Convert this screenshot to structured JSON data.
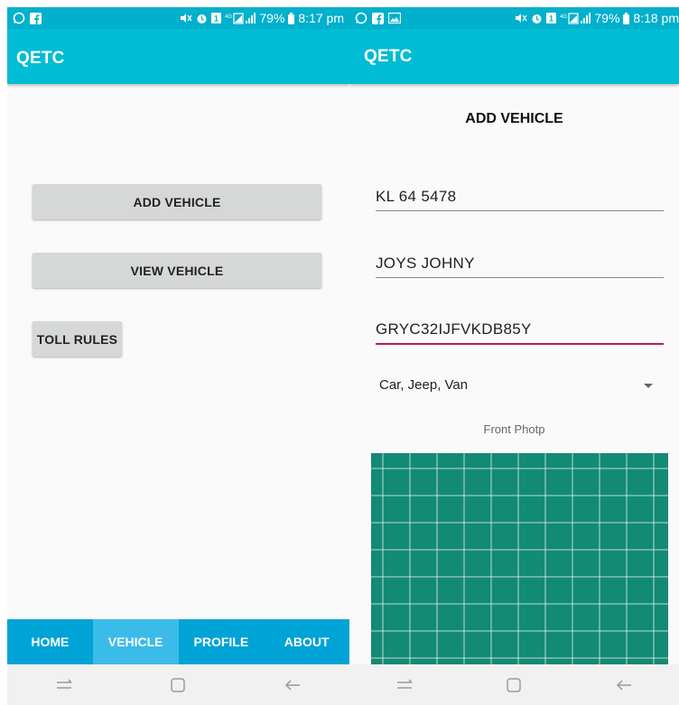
{
  "left": {
    "status": {
      "battery": "79%",
      "time": "8:17 pm"
    },
    "app_title": "QETC",
    "buttons": {
      "add_vehicle": "ADD VEHICLE",
      "view_vehicle": "VIEW VEHICLE",
      "toll_rules": "TOLL RULES"
    },
    "nav": [
      "HOME",
      "VEHICLE",
      "PROFILE",
      "ABOUT"
    ],
    "active_tab": "VEHICLE"
  },
  "right": {
    "status": {
      "battery": "79%",
      "time": "8:18 pm"
    },
    "app_title": "QETC",
    "heading": "ADD VEHICLE",
    "fields": {
      "reg_number": "KL 64 5478",
      "owner_name": "JOYS JOHNY",
      "chassis_number": "GRYC32IJFVKDB85Y"
    },
    "vehicle_type": "Car, Jeep, Van",
    "photo_label": "Front Photp"
  },
  "colors": {
    "appbar": "#00bcd4",
    "bottom_nav": "#00a3d6",
    "active_tab": "#3bbce8",
    "focus_underline": "#c2185b",
    "photo_bg": "#138a74"
  },
  "icons": [
    "whatsapp-icon",
    "facebook-icon",
    "gallery-icon",
    "mute-icon",
    "alarm-icon",
    "data-icon",
    "signal-icon",
    "battery-icon",
    "recents-icon",
    "home-key-icon",
    "back-icon"
  ]
}
